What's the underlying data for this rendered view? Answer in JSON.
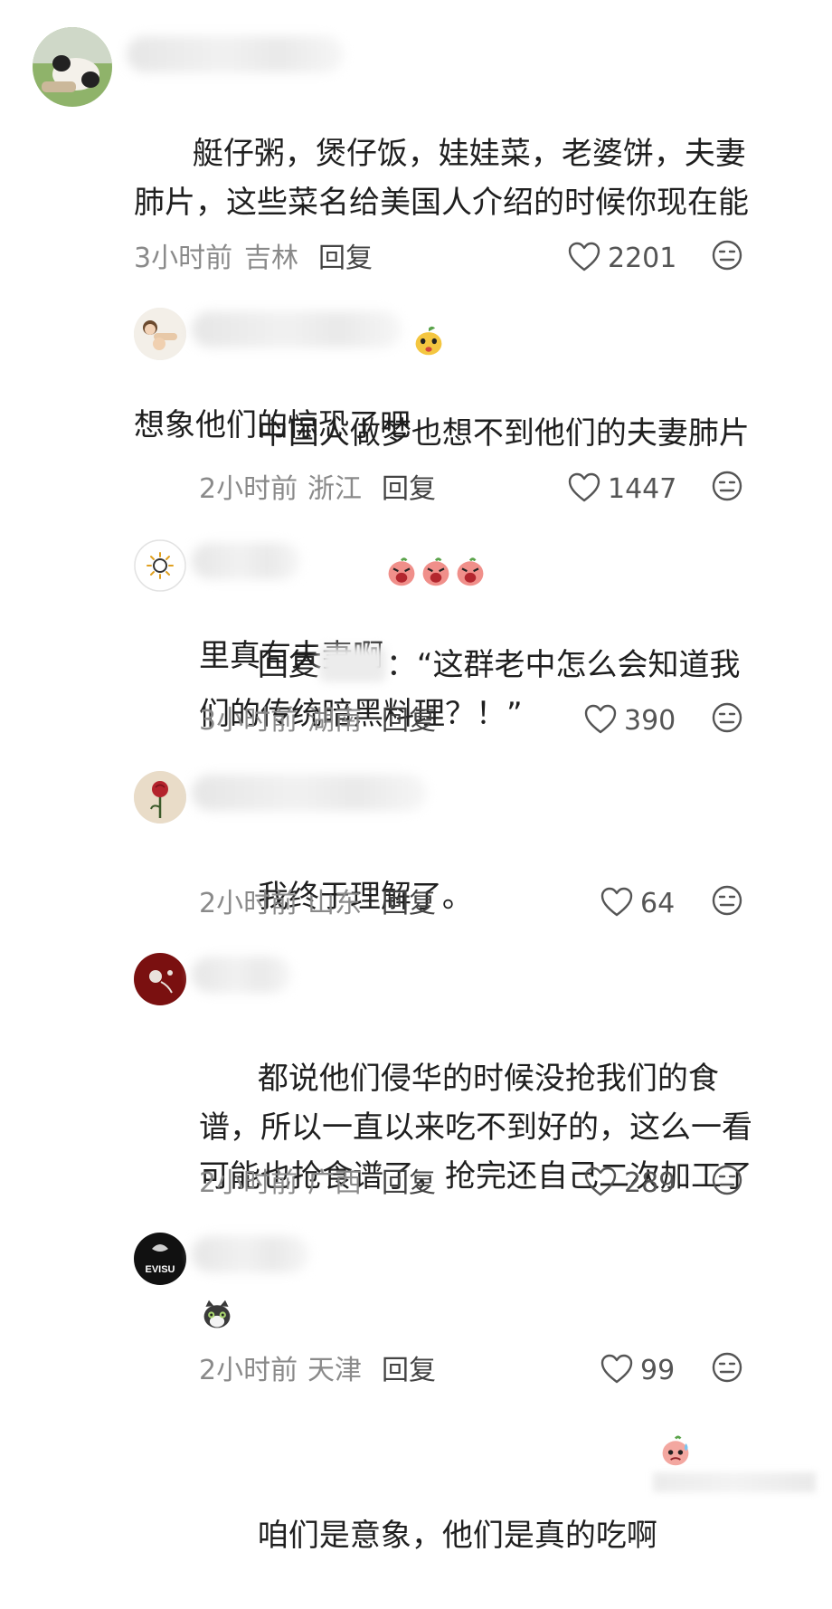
{
  "comments": [
    {
      "text": "艇仔粥，煲仔饭，娃娃菜，老婆饼，夫妻肺片，这些菜名给美国人介绍的时候你现在能想象他们的惊恐了吧",
      "emoji": [
        "peach-face-emoji"
      ],
      "time": "3小时前",
      "location": "吉林",
      "reply_label": "回复",
      "likes": "2201"
    },
    {
      "text": "中国人做梦也想不到他们的夫妻肺片里真有夫妻啊",
      "emoji": [
        "screaming-face-emoji",
        "screaming-face-emoji",
        "screaming-face-emoji"
      ],
      "time": "2小时前",
      "location": "浙江",
      "reply_label": "回复",
      "likes": "1447"
    },
    {
      "text_prefix": "回复",
      "text_suffix": "：“这群老中怎么会知道我们的传统暗黑料理？！”",
      "emoji": [],
      "time": "3小时前",
      "location": "湖南",
      "reply_label": "回复",
      "likes": "390"
    },
    {
      "text": "我终于理解了。",
      "emoji": [],
      "time": "2小时前",
      "location": "山东",
      "reply_label": "回复",
      "likes": "64"
    },
    {
      "text": "都说他们侵华的时候没抢我们的食谱，所以一直以来吃不到好的，这么一看可能也抢食谱了，抢完还自己二次加工了",
      "emoji": [
        "cat-face-emoji"
      ],
      "time": "2小时前",
      "location": "广西",
      "reply_label": "回复",
      "likes": "289"
    },
    {
      "text": "咱们是意象，他们是真的吃啊",
      "emoji": [
        "sweating-face-emoji"
      ],
      "time": "2小时前",
      "location": "天津",
      "reply_label": "回复",
      "likes": "99"
    }
  ],
  "avatar_text": "EVISU",
  "icons": {
    "like": "heart-outline-icon",
    "dislike": "meh-face-icon"
  },
  "colors": {
    "text": "#1f1f1f",
    "meta": "#8a8a8a",
    "reply": "#444444",
    "icon": "#555555"
  }
}
